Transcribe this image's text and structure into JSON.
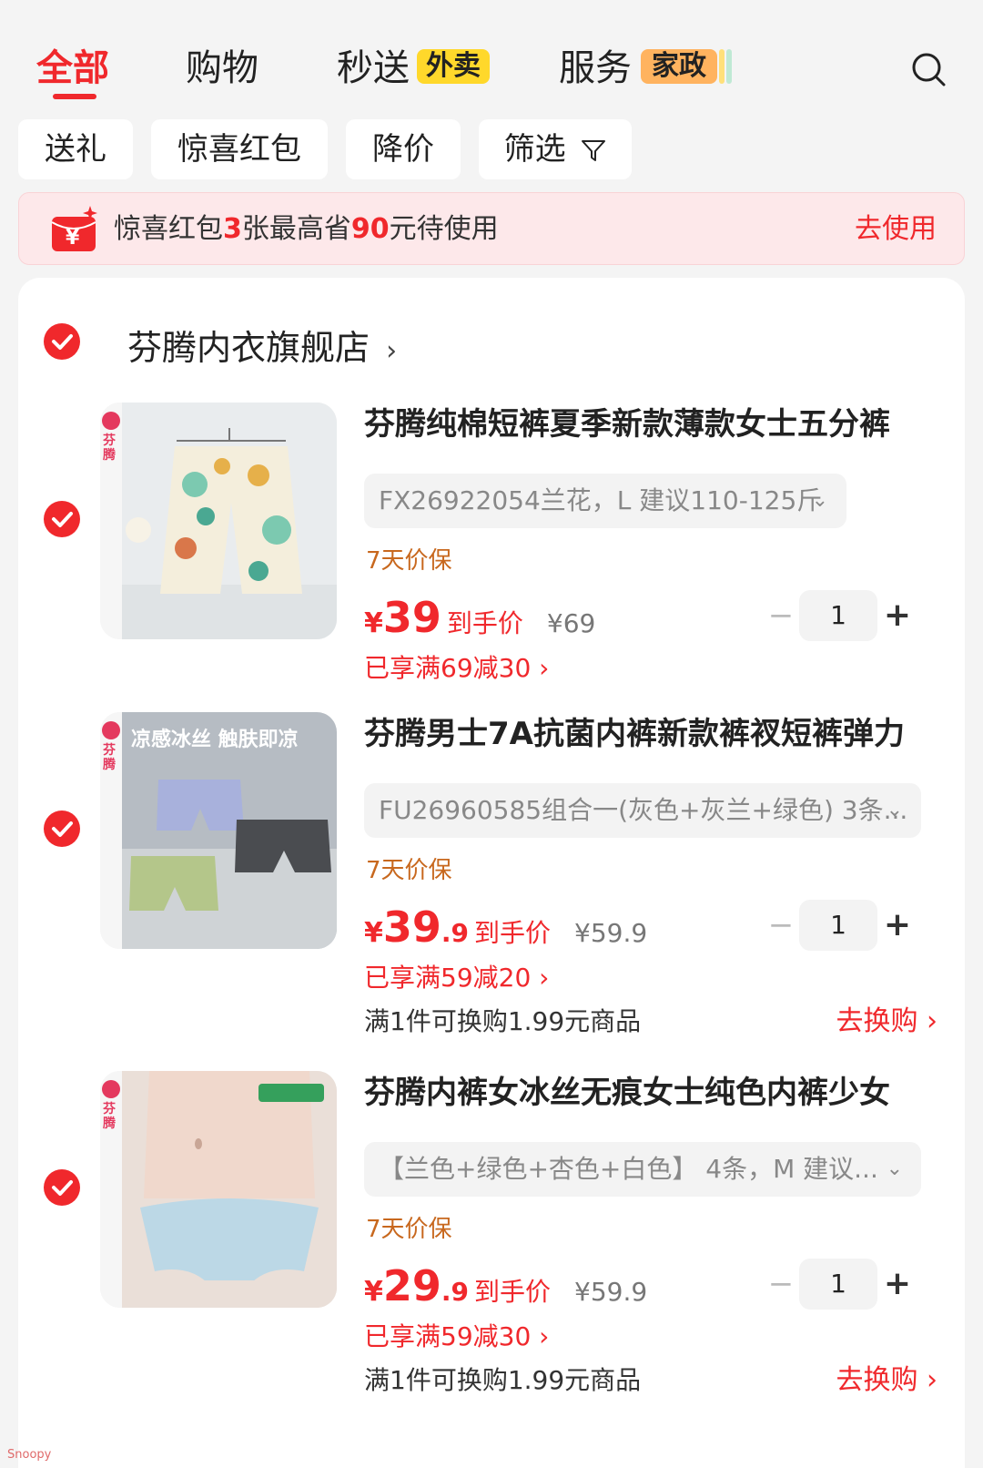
{
  "tabs": [
    {
      "label": "全部"
    },
    {
      "label": "购物"
    },
    {
      "label": "秒送",
      "tag": "外卖"
    },
    {
      "label": "服务",
      "tag": "家政"
    }
  ],
  "filters": [
    {
      "label": "送礼"
    },
    {
      "label": "惊喜红包"
    },
    {
      "label": "降价"
    },
    {
      "label": "筛选"
    }
  ],
  "banner": {
    "text_prefix": "惊喜红包",
    "count": "3",
    "text_mid": "张最高省",
    "amount": "90",
    "text_suffix": "元待使用",
    "action": "去使用"
  },
  "store": {
    "name": "芬腾内衣旗舰店",
    "arrow": "›"
  },
  "products": [
    {
      "title": "芬腾纯棉短裤夏季新款薄款女士五分裤",
      "sku": "FX26922054兰花，L 建议110-125斤",
      "guarantee": "7天价保",
      "price_yen": "¥",
      "price_int": "39",
      "price_dec": "",
      "price_label": "到手价",
      "orig_price": "¥69",
      "promo": "已享满69减30 ›",
      "quantity": "1",
      "brand_text": "芬腾"
    },
    {
      "title": "芬腾男士7A抗菌内裤新款裤衩短裤弹力",
      "sku": "FU26960585组合一(灰色+灰兰+绿色) 3条...",
      "guarantee": "7天价保",
      "price_yen": "¥",
      "price_int": "39",
      "price_dec": ".9",
      "price_label": "到手价",
      "orig_price": "¥59.9",
      "promo": "已享满59减20 ›",
      "swap_text": "满1件可换购1.99元商品",
      "swap_action": "去换购 ›",
      "quantity": "1",
      "brand_text": "芬腾",
      "image_text": "凉感冰丝 触肤即凉"
    },
    {
      "title": "芬腾内裤女冰丝无痕女士纯色内裤少女",
      "sku": "【兰色+绿色+杏色+白色】 4条，M 建议...",
      "guarantee": "7天价保",
      "price_yen": "¥",
      "price_int": "29",
      "price_dec": ".9",
      "price_label": "到手价",
      "orig_price": "¥59.9",
      "promo": "已享满59减30 ›",
      "swap_text": "满1件可换购1.99元商品",
      "swap_action": "去换购 ›",
      "quantity": "1",
      "brand_text": "芬腾"
    }
  ],
  "watermark": "Snoopy",
  "colors": {
    "accent": "#f0282c",
    "guarantee": "#c8681e",
    "tag_yellow": "#ffd82b",
    "tag_orange": "#ffb35f"
  },
  "icons": {
    "search": "search-icon",
    "filter": "funnel-icon",
    "check": "check-circle-icon",
    "red_packet": "red-packet-icon"
  }
}
